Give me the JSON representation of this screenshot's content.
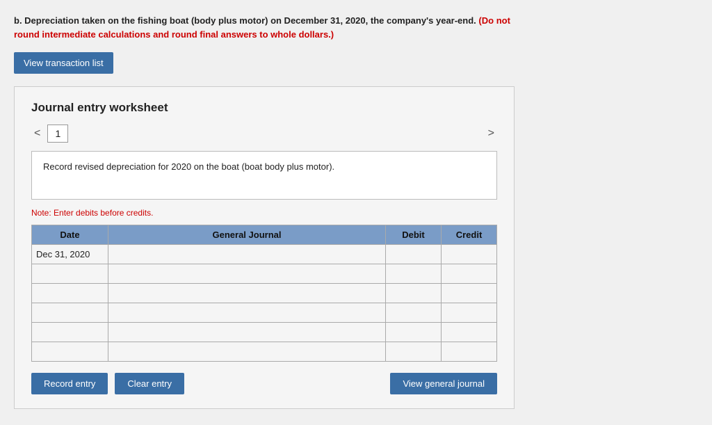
{
  "problem": {
    "text_prefix": "b. Depreciation taken on the fishing boat (body plus motor) on December 31, 2020, the company's year-end.",
    "text_red": "(Do not round intermediate calculations and round final answers to whole dollars.)"
  },
  "view_transaction_btn": "View transaction list",
  "worksheet": {
    "title": "Journal entry worksheet",
    "page_number": "1",
    "nav_left": "<",
    "nav_right": ">",
    "description": "Record revised depreciation for 2020 on the boat (boat body plus motor).",
    "note": "Note: Enter debits before credits.",
    "table": {
      "headers": {
        "date": "Date",
        "general_journal": "General Journal",
        "debit": "Debit",
        "credit": "Credit"
      },
      "rows": [
        {
          "date": "Dec 31, 2020",
          "gj": "",
          "debit": "",
          "credit": ""
        },
        {
          "date": "",
          "gj": "",
          "debit": "",
          "credit": ""
        },
        {
          "date": "",
          "gj": "",
          "debit": "",
          "credit": ""
        },
        {
          "date": "",
          "gj": "",
          "debit": "",
          "credit": ""
        },
        {
          "date": "",
          "gj": "",
          "debit": "",
          "credit": ""
        },
        {
          "date": "",
          "gj": "",
          "debit": "",
          "credit": ""
        }
      ]
    }
  },
  "buttons": {
    "record_entry": "Record entry",
    "clear_entry": "Clear entry",
    "view_general_journal": "View general journal"
  }
}
